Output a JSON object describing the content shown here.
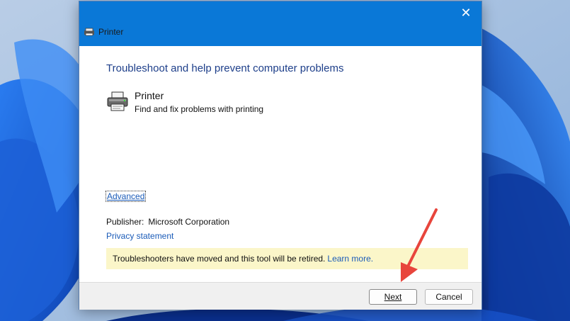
{
  "window": {
    "title": "Printer",
    "close_label": "✕"
  },
  "content": {
    "heading": "Troubleshoot and help prevent computer problems",
    "item": {
      "title": "Printer",
      "description": "Find and fix problems with printing"
    },
    "advanced_link": "Advanced",
    "publisher_label": "Publisher:",
    "publisher_value": "Microsoft Corporation",
    "privacy_link": "Privacy statement",
    "notice_text": "Troubleshooters have moved and this tool will be retired.",
    "notice_link": "Learn more."
  },
  "footer": {
    "next_label": "Next",
    "cancel_label": "Cancel"
  },
  "colors": {
    "titlebar": "#0a78d7",
    "link": "#1a5bb8",
    "notice_bg": "#fbf6c9",
    "annotation_arrow": "#e8453c"
  },
  "icons": [
    "printer-icon",
    "close-icon",
    "arrow-annotation"
  ]
}
